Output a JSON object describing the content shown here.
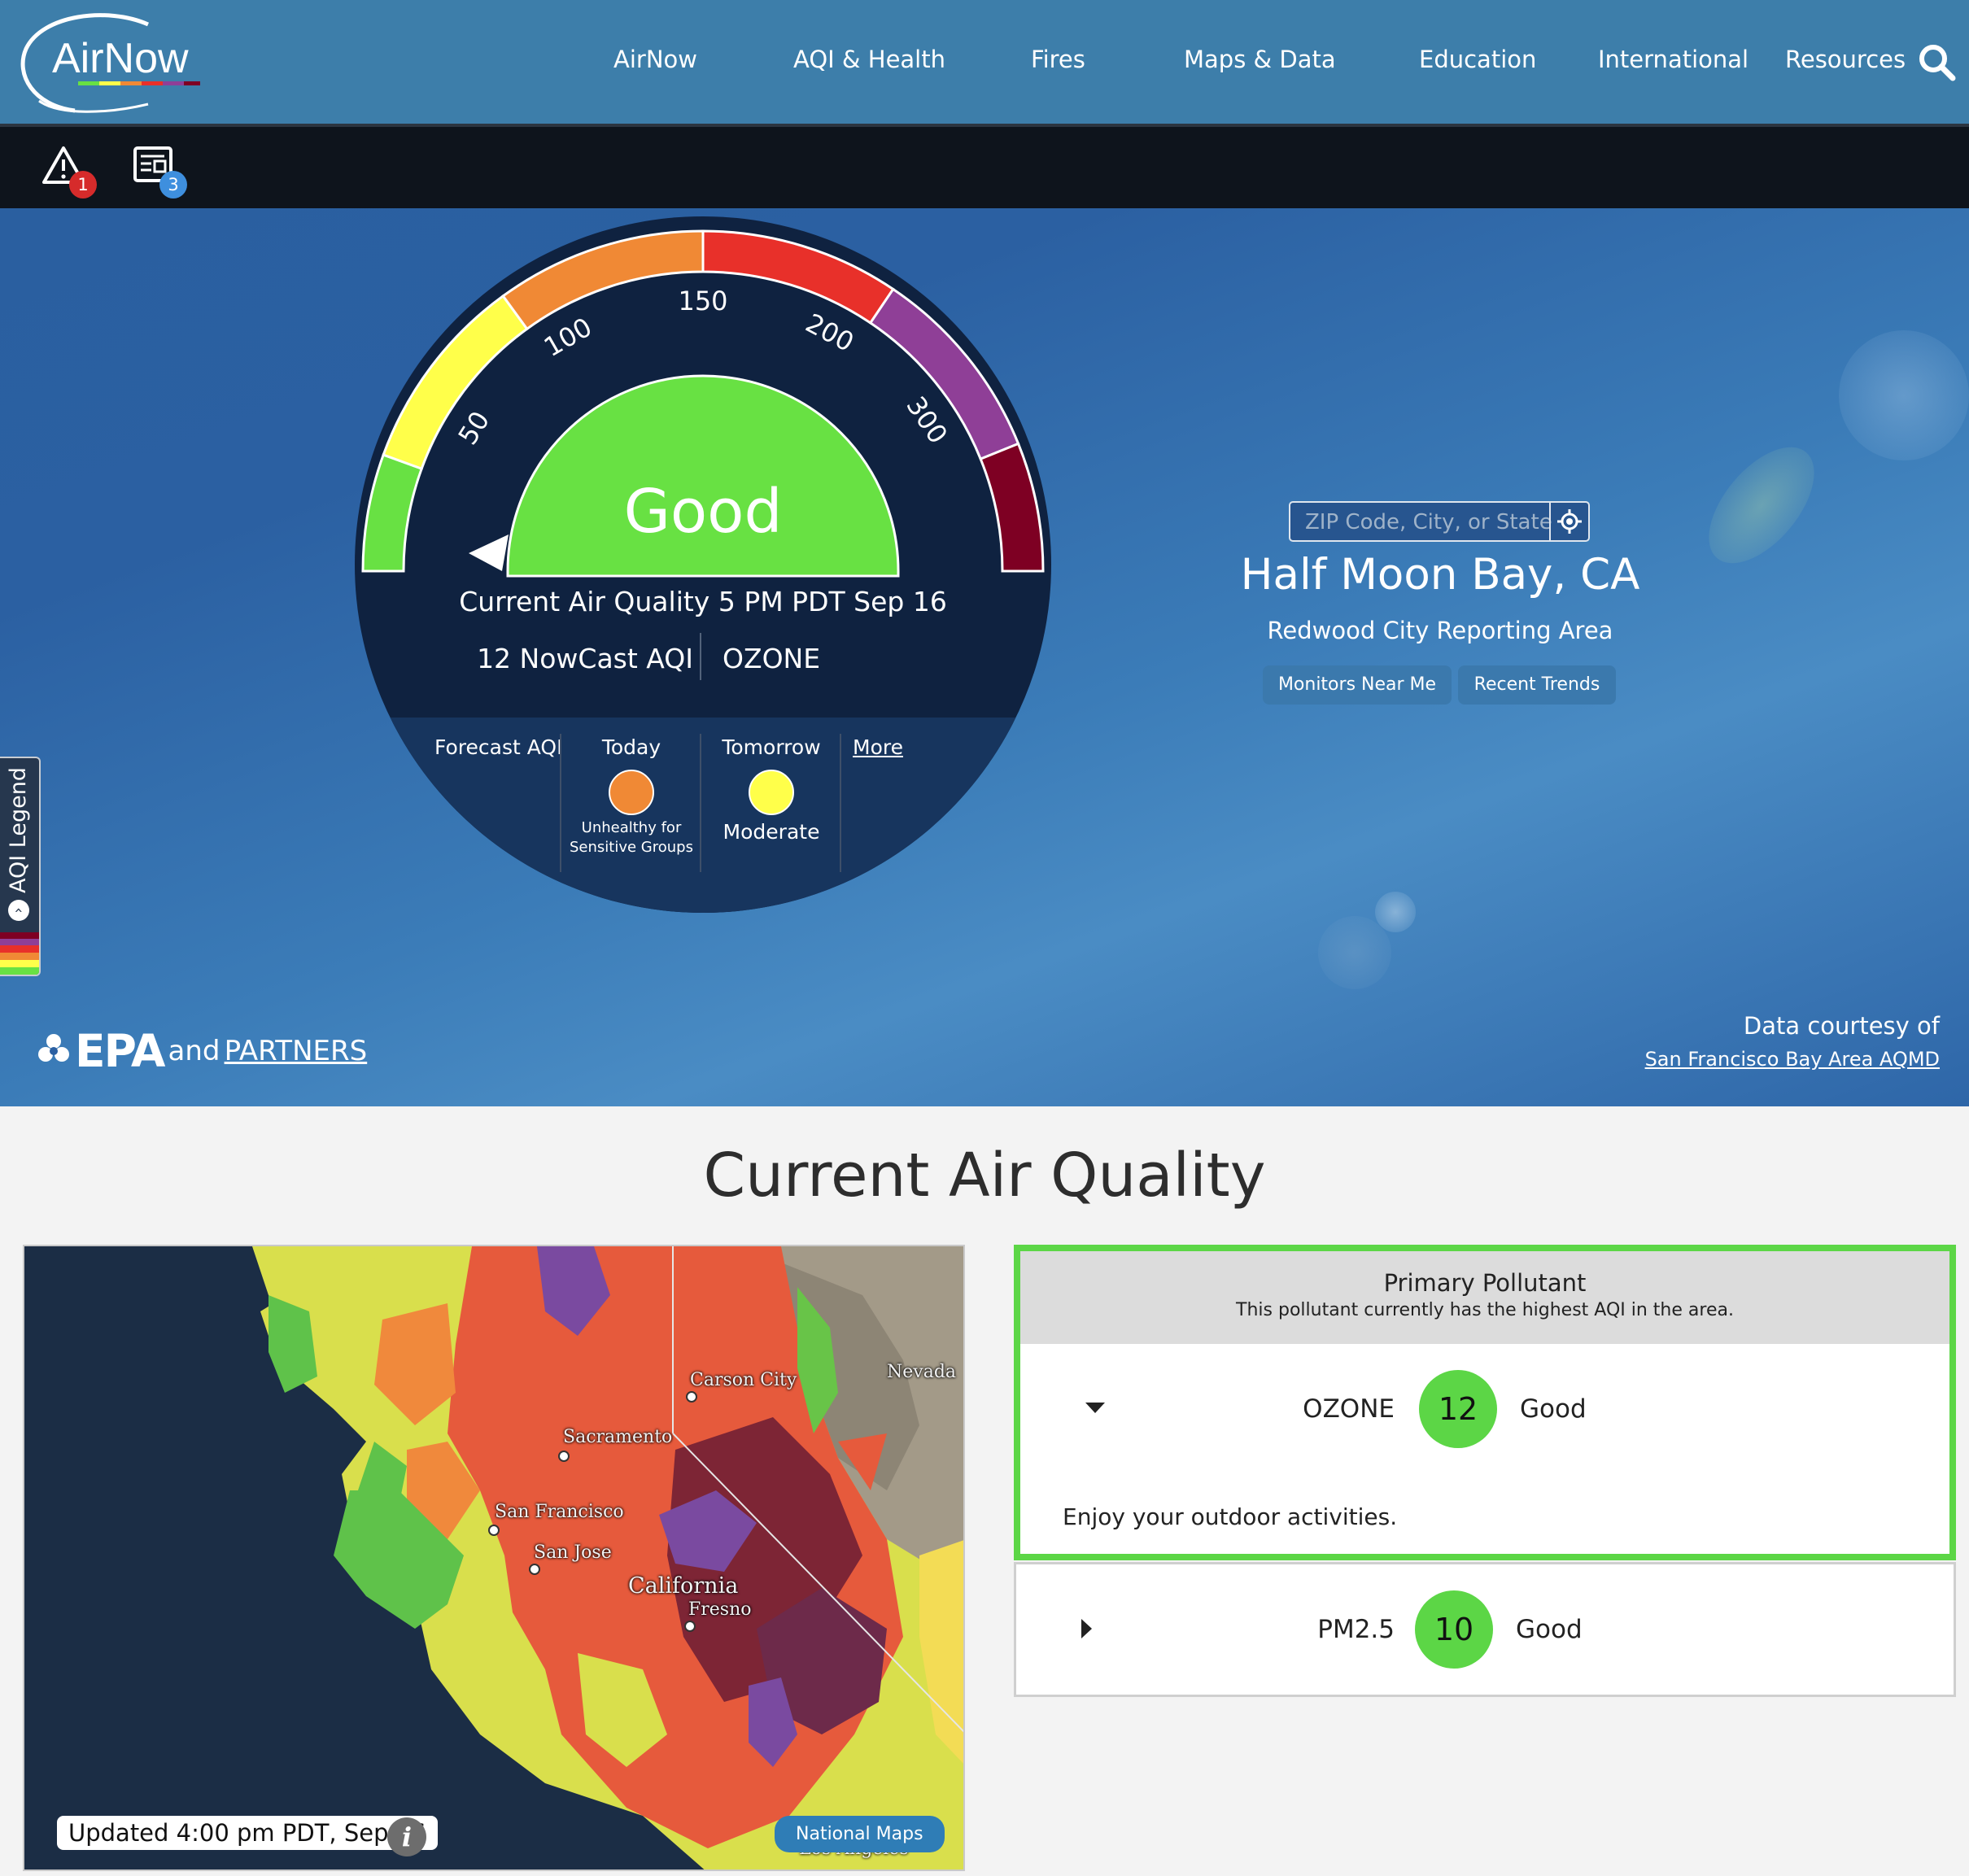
{
  "header": {
    "logo_text": "AirNow",
    "nav": [
      "AirNow",
      "AQI & Health",
      "Fires",
      "Maps & Data",
      "Education",
      "International",
      "Resources"
    ]
  },
  "alerts": {
    "alert_count": "1",
    "news_count": "3"
  },
  "gauge": {
    "category": "Good",
    "aqi_value": 12,
    "tick_labels": [
      "50",
      "100",
      "150",
      "200",
      "300"
    ],
    "colors": {
      "good": "#68e143",
      "moderate": "#ffff4a",
      "usg": "#f08935",
      "unhealthy": "#e8302a",
      "very_unhealthy": "#8f3f97",
      "hazardous": "#7e0023"
    },
    "current_label": "Current Air Quality 5 PM PDT Sep 16",
    "nowcast": "12 NowCast AQI",
    "pollutant": "OZONE"
  },
  "forecast": {
    "label": "Forecast AQI",
    "today_label": "Today",
    "today_category": "Unhealthy for Sensitive Groups",
    "today_category_line1": "Unhealthy for",
    "today_category_line2": "Sensitive Groups",
    "tomorrow_label": "Tomorrow",
    "tomorrow_category": "Moderate",
    "more_link": "More"
  },
  "legend_tab": {
    "label": "AQI Legend"
  },
  "location": {
    "search_placeholder": "ZIP Code, City, or State",
    "city": "Half Moon Bay, CA",
    "reporting_area": "Redwood City Reporting Area",
    "monitors_button": "Monitors Near Me",
    "trends_button": "Recent Trends"
  },
  "footer_hero": {
    "epa": "EPA",
    "and": "and",
    "partners": "PARTNERS",
    "courtesy": "Data courtesy of",
    "courtesy_source": "San Francisco Bay Area AQMD"
  },
  "section": {
    "title": "Current Air Quality"
  },
  "map": {
    "labels": [
      "Carson City",
      "Nevada",
      "Sacramento",
      "San Francisco",
      "San Jose",
      "California",
      "Fresno",
      "Los Angeles"
    ],
    "updated": "Updated 4:00 pm PDT, Sep 16",
    "info": "i",
    "national_maps": "National Maps"
  },
  "primary_pollutant": {
    "title": "Primary Pollutant",
    "subtitle": "This pollutant currently has the highest AQI in the area.",
    "pollutants": [
      {
        "name": "OZONE",
        "aqi": "12",
        "category": "Good",
        "message": "Enjoy your outdoor activities.",
        "color": "#5cd646"
      },
      {
        "name": "PM2.5",
        "aqi": "10",
        "category": "Good",
        "color": "#5cd646"
      }
    ]
  }
}
